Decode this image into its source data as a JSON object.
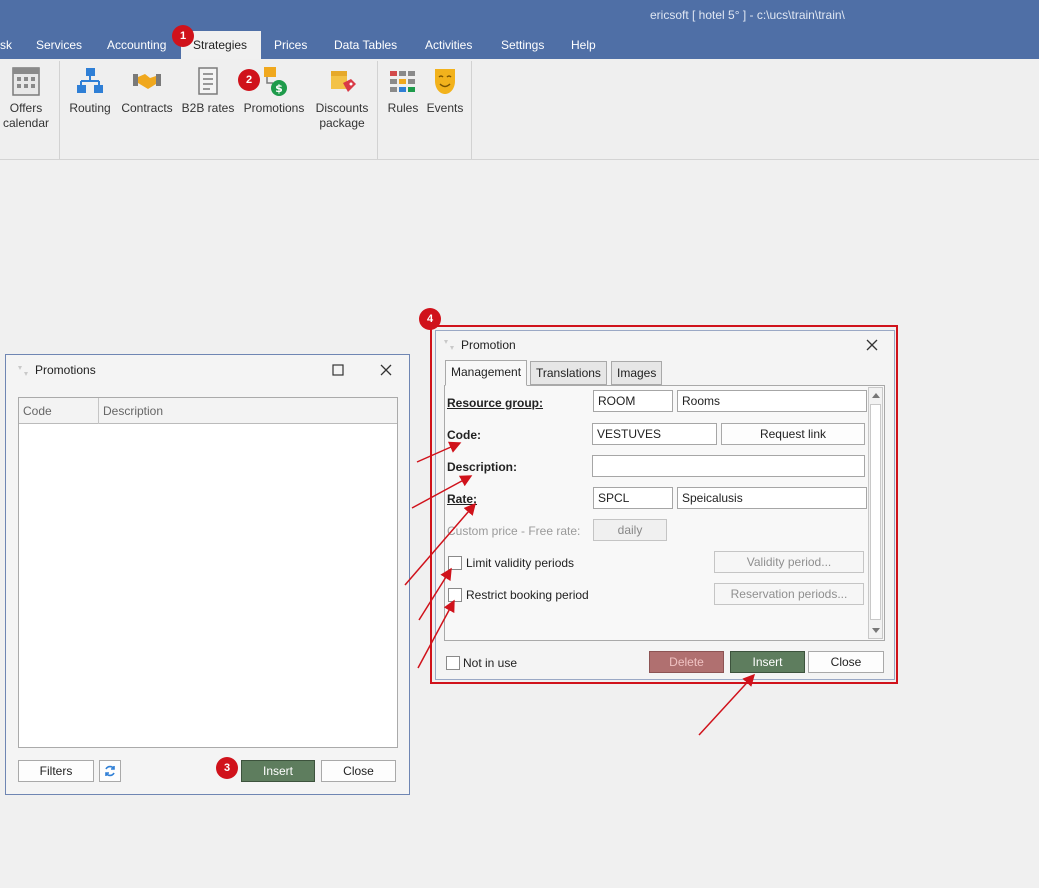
{
  "window": {
    "title": "ericsoft [ hotel 5° ] - c:\\ucs\\train\\train\\"
  },
  "menu": [
    {
      "label": "sk"
    },
    {
      "label": "Services"
    },
    {
      "label": "Accounting"
    },
    {
      "label": "Strategies"
    },
    {
      "label": "Prices"
    },
    {
      "label": "Data Tables"
    },
    {
      "label": "Activities"
    },
    {
      "label": "Settings"
    },
    {
      "label": "Help"
    }
  ],
  "ribbon": {
    "offers_calendar": {
      "line1": "Offers",
      "line2": "calendar"
    },
    "routing": "Routing",
    "contracts": "Contracts",
    "b2b_rates": "B2B rates",
    "promotions": "Promotions",
    "discounts_package": {
      "line1": "Discounts",
      "line2": "package"
    },
    "rules": "Rules",
    "events": "Events"
  },
  "badges": {
    "b1": "1",
    "b2": "2",
    "b3": "3",
    "b4": "4"
  },
  "promotions_window": {
    "title": "Promotions",
    "columns": [
      "Code",
      "Description"
    ],
    "filters": "Filters",
    "insert": "Insert",
    "close": "Close"
  },
  "promotion_dialog": {
    "title": "Promotion",
    "tabs": [
      "Management",
      "Translations",
      "Images"
    ],
    "resource_group": {
      "label": "Resource group:",
      "code": "ROOM",
      "name": "Rooms"
    },
    "code": {
      "label": "Code:",
      "value": "VESTUVES",
      "request_link": "Request link"
    },
    "description": {
      "label": "Description:",
      "value": ""
    },
    "rate": {
      "label": "Rate:",
      "code": "SPCL",
      "name": "Speicalusis"
    },
    "custom_price": {
      "label": "Custom price - Free rate:",
      "value": "daily"
    },
    "limit_validity": {
      "label": "Limit validity periods",
      "button": "Validity period..."
    },
    "restrict_booking": {
      "label": "Restrict booking period",
      "button": "Reservation periods..."
    },
    "not_in_use": "Not in use",
    "delete": "Delete",
    "insert": "Insert",
    "close": "Close"
  },
  "colors": {
    "accent": "#4f6fa6",
    "annotation": "#d0121b",
    "primary_button": "#5e7d5e"
  }
}
